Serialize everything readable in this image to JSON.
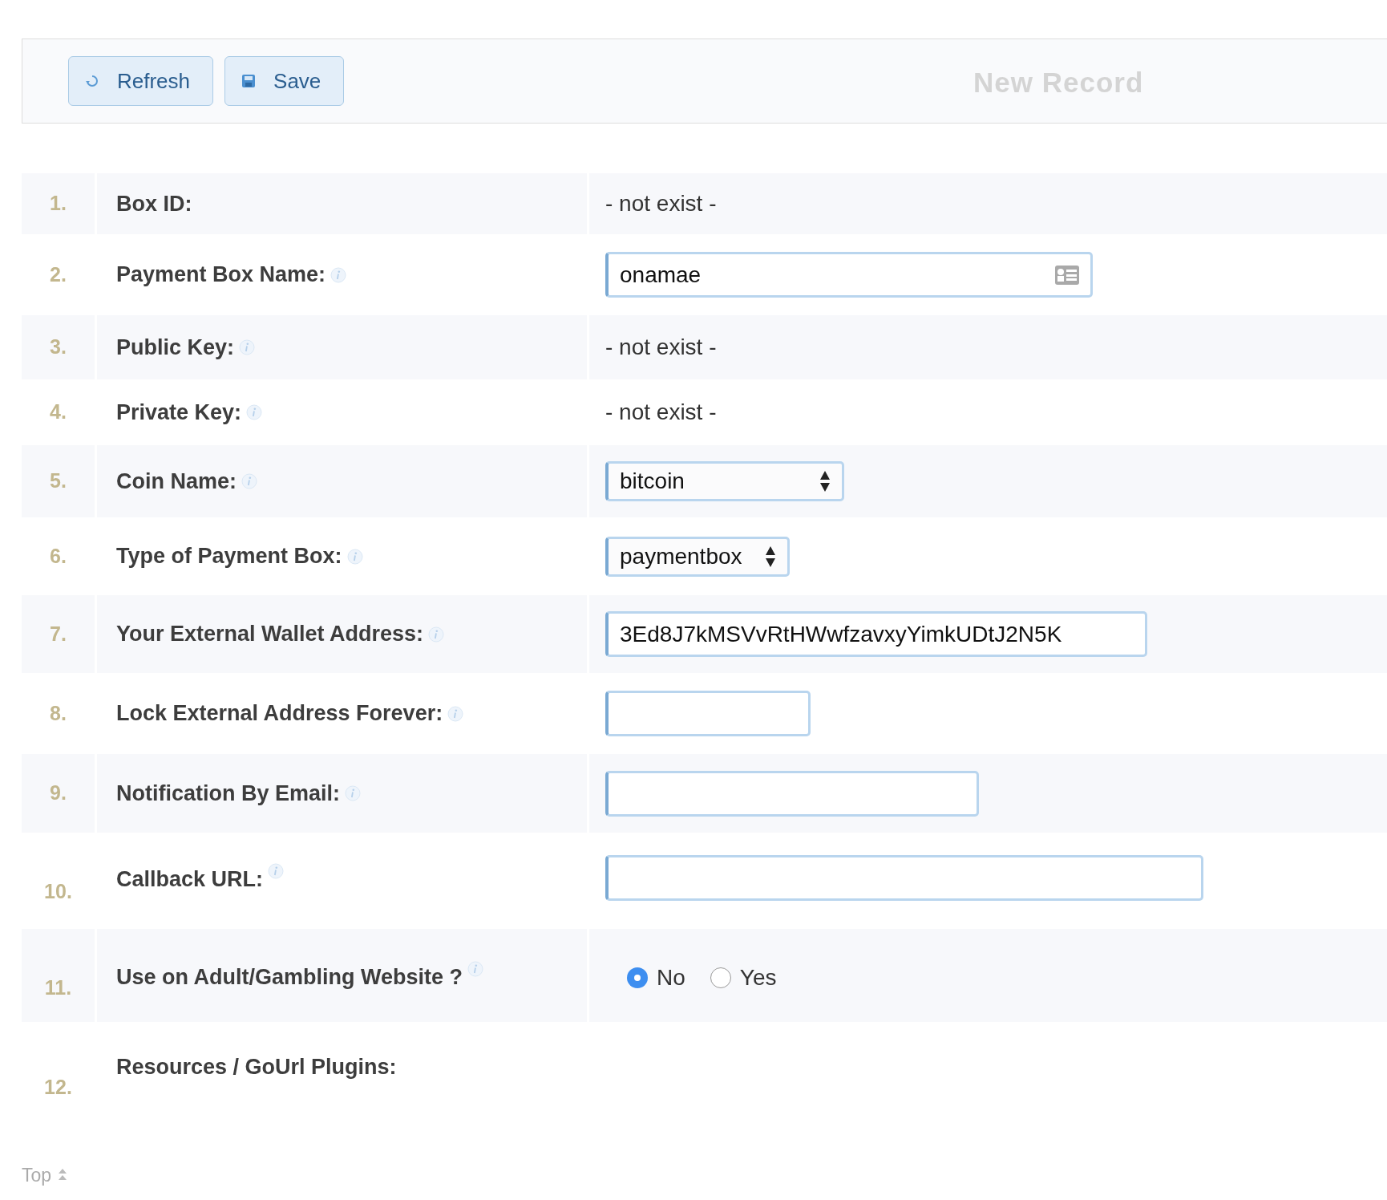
{
  "toolbar": {
    "buttons": [
      {
        "kind": "refresh",
        "label": "Refresh"
      },
      {
        "kind": "save",
        "label": "Save"
      }
    ],
    "title": "New Record"
  },
  "rows": [
    {
      "number": "1.",
      "label": "Box ID:",
      "info": false,
      "kind": "text",
      "value": "- not exist -"
    },
    {
      "number": "2.",
      "label": "Payment Box Name:",
      "info": true,
      "kind": "input",
      "value": "onamae",
      "card_icon": true
    },
    {
      "number": "3.",
      "label": "Public Key:",
      "info": true,
      "kind": "text",
      "value": "- not exist -"
    },
    {
      "number": "4.",
      "label": "Private Key:",
      "info": true,
      "kind": "text",
      "value": "- not exist -"
    },
    {
      "number": "5.",
      "label": "Coin Name:",
      "info": true,
      "kind": "select",
      "value": "bitcoin"
    },
    {
      "number": "6.",
      "label": "Type of Payment Box:",
      "info": true,
      "kind": "select",
      "value": "paymentbox"
    },
    {
      "number": "7.",
      "label": "Your External Wallet Address:",
      "info": true,
      "kind": "input",
      "value": "3Ed8J7kMSVvRtHWwfzavxyYimkUDtJ2N5K"
    },
    {
      "number": "8.",
      "label": "Lock External Address Forever:",
      "info": true,
      "kind": "input"
    },
    {
      "number": "9.",
      "label": "Notification By Email:",
      "info": true,
      "kind": "input"
    },
    {
      "number": "10.",
      "label": "Callback URL:",
      "info": true,
      "kind": "input"
    },
    {
      "number": "11.",
      "label": "Use on Adult/Gambling Website ?",
      "info": true,
      "kind": "radio",
      "options": [
        {
          "label": "No",
          "selected": true
        },
        {
          "label": "Yes",
          "selected": false
        }
      ]
    },
    {
      "number": "12.",
      "label": "Resources / GoUrl Plugins:",
      "info": false,
      "kind": "none"
    }
  ],
  "footer": {
    "link": "Top"
  }
}
